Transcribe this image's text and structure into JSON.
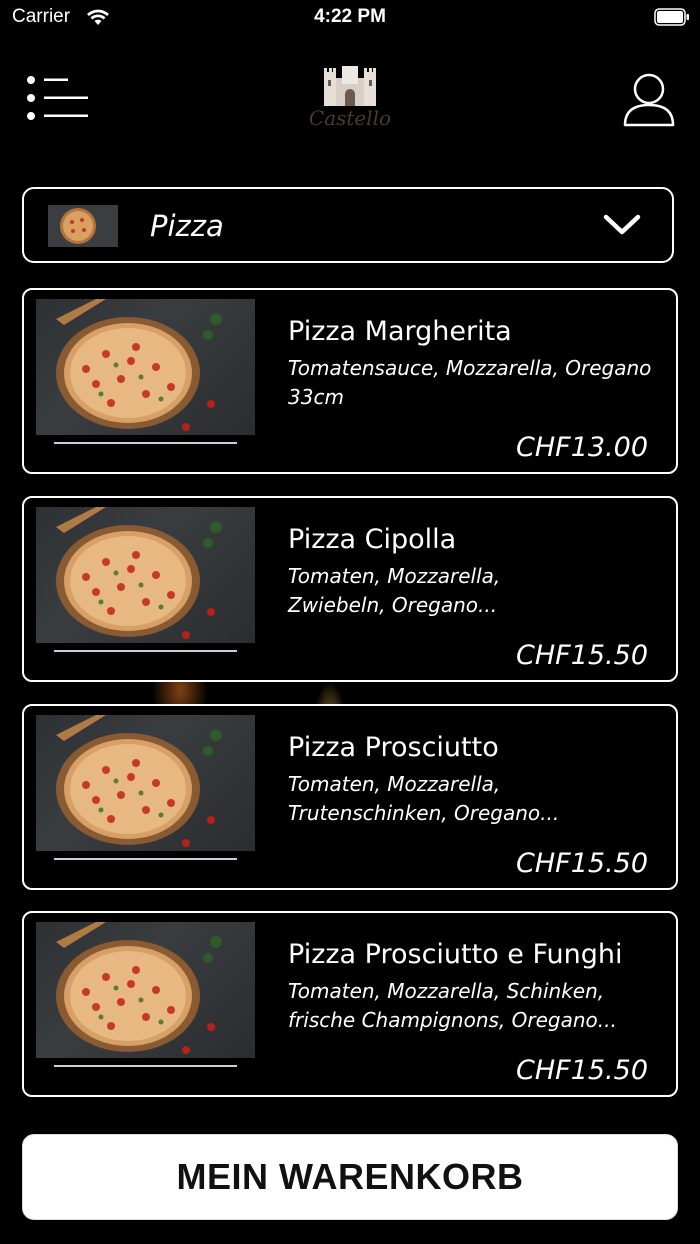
{
  "status_bar": {
    "carrier": "Carrier",
    "time": "4:22 PM"
  },
  "header": {
    "logo_text": "Castello"
  },
  "category": {
    "selected": "Pizza"
  },
  "products": [
    {
      "name": "Pizza Margherita",
      "description": "Tomatensauce, Mozzarella, Oregano 33cm",
      "price": "CHF13.00"
    },
    {
      "name": "Pizza Cipolla",
      "description": "Tomaten, Mozzarella, Zwiebeln, Oregano...",
      "price": "CHF15.50"
    },
    {
      "name": "Pizza Prosciutto",
      "description": "Tomaten, Mozzarella, Trutenschinken, Oregano...",
      "price": "CHF15.50"
    },
    {
      "name": "Pizza Prosciutto e Funghi",
      "description": "Tomaten, Mozzarella, Schinken, frische Champignons, Oregano...",
      "price": "CHF15.50"
    }
  ],
  "cart": {
    "label": "MEIN WARENKORB"
  },
  "colors": {
    "background": "#000000",
    "accent": "#ffffff",
    "cart_text": "#111111"
  }
}
